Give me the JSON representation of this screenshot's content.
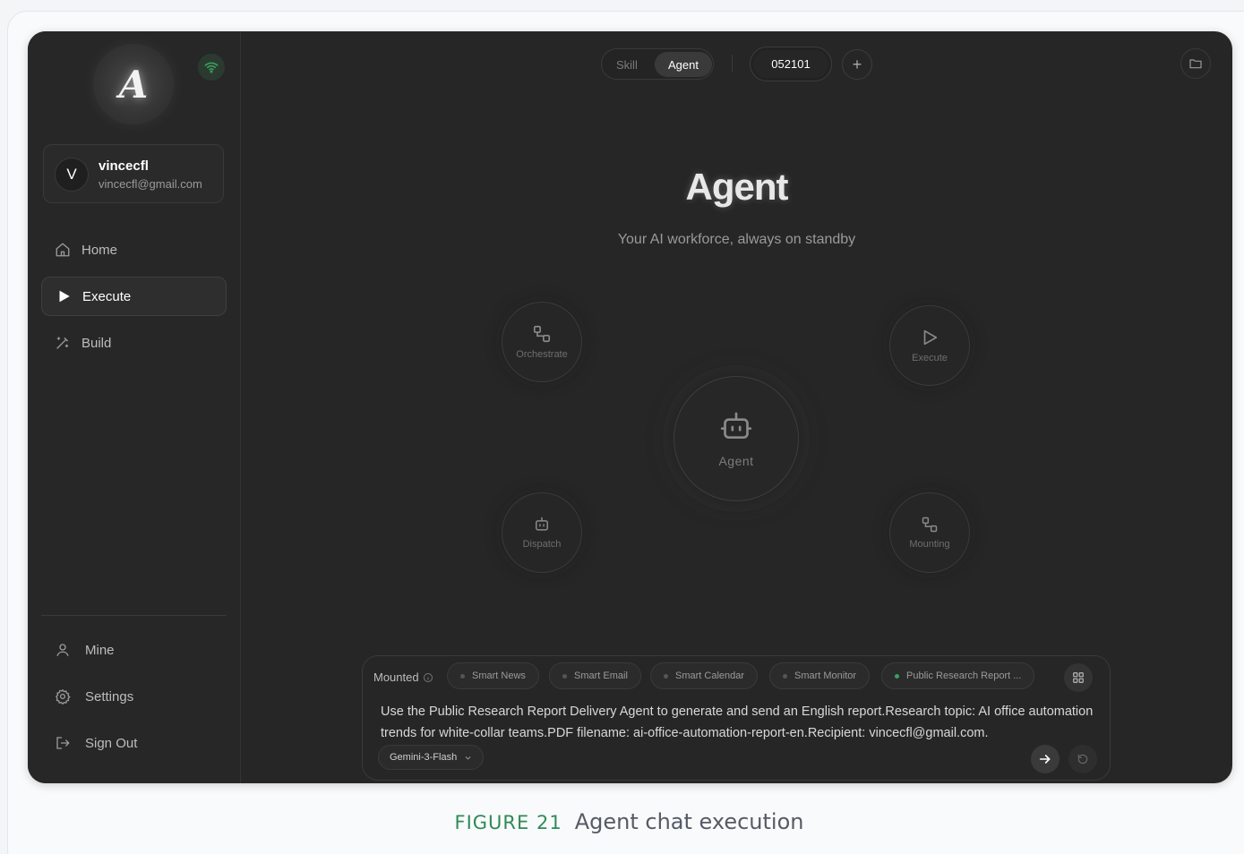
{
  "app": {
    "logo_letter": "A",
    "connection_status_icon": "wifi-icon",
    "accent_color": "#3aa05a"
  },
  "user": {
    "avatar_initial": "V",
    "name": "vincecfl",
    "email": "vincecfl@gmail.com"
  },
  "sidebar": {
    "items": [
      {
        "label": "Home",
        "icon": "home-icon"
      },
      {
        "label": "Execute",
        "icon": "play-icon"
      },
      {
        "label": "Build",
        "icon": "magic-wand-icon"
      }
    ],
    "bottom_items": [
      {
        "label": "Mine",
        "icon": "user-icon"
      },
      {
        "label": "Settings",
        "icon": "gear-icon"
      },
      {
        "label": "Sign Out",
        "icon": "sign-out-icon"
      }
    ]
  },
  "topbar": {
    "mode_skill": "Skill",
    "mode_agent": "Agent",
    "session_id": "052101",
    "add_label": "+"
  },
  "hero": {
    "title": "Agent",
    "subtitle": "Your AI workforce, always on standby",
    "nodes": {
      "orchestrate": "Orchestrate",
      "execute": "Execute",
      "agent": "Agent",
      "dispatch": "Dispatch",
      "mounting": "Mounting"
    }
  },
  "composer": {
    "mounted_label": "Mounted",
    "chips": [
      "Smart News",
      "Smart Email",
      "Smart Calendar",
      "Smart Monitor",
      "Public Research Report ..."
    ],
    "prompt": "Use the Public Research Report Delivery Agent to generate and send an English report.Research topic: AI office automation trends for white-collar teams.PDF filename: ai-office-automation-report-en.Recipient: vincecfl@gmail.com.",
    "model": "Gemini-3-Flash"
  },
  "caption": {
    "figure": "FIGURE 21",
    "text": "Agent chat execution"
  }
}
